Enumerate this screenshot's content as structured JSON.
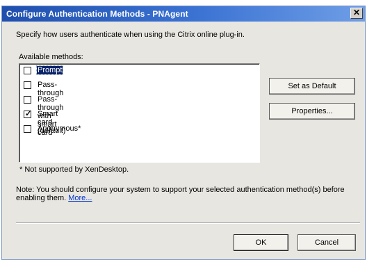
{
  "window": {
    "title": "Configure Authentication Methods - PNAgent",
    "close_glyph": "✕"
  },
  "description": "Specify how users authenticate when using the Citrix online plug-in.",
  "available_label": "Available methods:",
  "methods": [
    {
      "label": "Prompt",
      "checked": false,
      "selected": true
    },
    {
      "label": "Pass-through",
      "checked": false,
      "selected": false
    },
    {
      "label": "Pass-through with smart card",
      "checked": false,
      "selected": false
    },
    {
      "label": "Smart card (default)",
      "checked": true,
      "selected": false
    },
    {
      "label": "Anonymous*",
      "checked": false,
      "selected": false
    }
  ],
  "buttons": {
    "set_default": "Set as Default",
    "properties": "Properties...",
    "ok": "OK",
    "cancel": "Cancel"
  },
  "footnote": "* Not supported by XenDesktop.",
  "note": {
    "text": "Note: You should configure your system to support your selected authentication method(s) before enabling them.",
    "link": "More..."
  },
  "check_glyph": "✓",
  "colors": {
    "title_gradient_start": "#1f4fae",
    "title_gradient_end": "#6f9ee6",
    "selection": "#0a246a",
    "link": "#0033cc"
  }
}
